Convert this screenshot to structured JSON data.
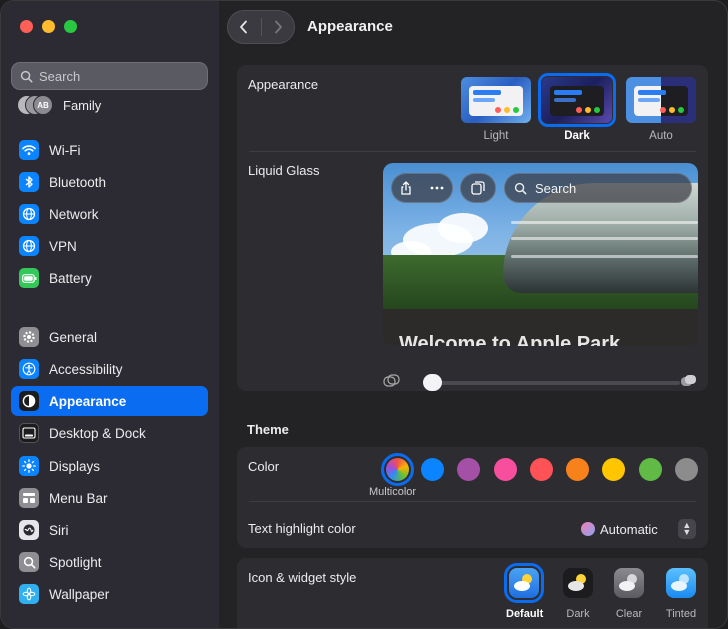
{
  "sidebar": {
    "search_placeholder": "Search",
    "family": {
      "label": "Family",
      "avatar_initials": "AB"
    },
    "items": [
      {
        "label": "Wi-Fi",
        "icon": "wifi-icon",
        "color": "#0a84ff"
      },
      {
        "label": "Bluetooth",
        "icon": "bluetooth-icon",
        "color": "#0a84ff"
      },
      {
        "label": "Network",
        "icon": "globe-icon",
        "color": "#0a84ff"
      },
      {
        "label": "VPN",
        "icon": "vpn-globe-icon",
        "color": "#0a84ff"
      },
      {
        "label": "Battery",
        "icon": "battery-icon",
        "color": "#34c759"
      },
      {
        "label": "General",
        "icon": "gear-icon",
        "color": "#8e8e93"
      },
      {
        "label": "Accessibility",
        "icon": "accessibility-icon",
        "color": "#0a84ff"
      },
      {
        "label": "Appearance",
        "icon": "appearance-icon",
        "color": "#1c1c1e",
        "active": true
      },
      {
        "label": "Desktop & Dock",
        "icon": "dock-icon",
        "color": "#1c1c1e"
      },
      {
        "label": "Displays",
        "icon": "sun-icon",
        "color": "#0a84ff"
      },
      {
        "label": "Menu Bar",
        "icon": "menubar-icon",
        "color": "#8e8e93"
      },
      {
        "label": "Siri",
        "icon": "siri-icon",
        "color": "#e6e6ea"
      },
      {
        "label": "Spotlight",
        "icon": "magnifier-icon",
        "color": "#8e8e93"
      },
      {
        "label": "Wallpaper",
        "icon": "flower-icon",
        "color": "#30b0f0"
      }
    ]
  },
  "titlebar": {
    "title": "Appearance",
    "back": "‹",
    "forward": "›"
  },
  "appearance": {
    "label": "Appearance",
    "options": [
      {
        "label": "Light",
        "selected": false
      },
      {
        "label": "Dark",
        "selected": true
      },
      {
        "label": "Auto",
        "selected": false
      }
    ]
  },
  "liquid_glass": {
    "label": "Liquid Glass",
    "preview_search": "Search",
    "preview_headline": "Welcome to Apple Park",
    "slider_value": 0
  },
  "theme": {
    "section_title": "Theme",
    "color_label": "Color",
    "selected_color_caption": "Multicolor",
    "colors": [
      "multicolor",
      "#0a84ff",
      "#a550a7",
      "#f74f9e",
      "#ff5257",
      "#f7821b",
      "#ffc600",
      "#62ba46",
      "#8c8c8c"
    ],
    "highlight_label": "Text highlight color",
    "highlight_value": "Automatic",
    "stepper_up": "▲",
    "stepper_down": "▼"
  },
  "icon_style": {
    "label": "Icon & widget style",
    "options": [
      {
        "label": "Default",
        "selected": true
      },
      {
        "label": "Dark",
        "selected": false
      },
      {
        "label": "Clear",
        "selected": false
      },
      {
        "label": "Tinted",
        "selected": false
      }
    ]
  },
  "accent": "#0a6cf0"
}
